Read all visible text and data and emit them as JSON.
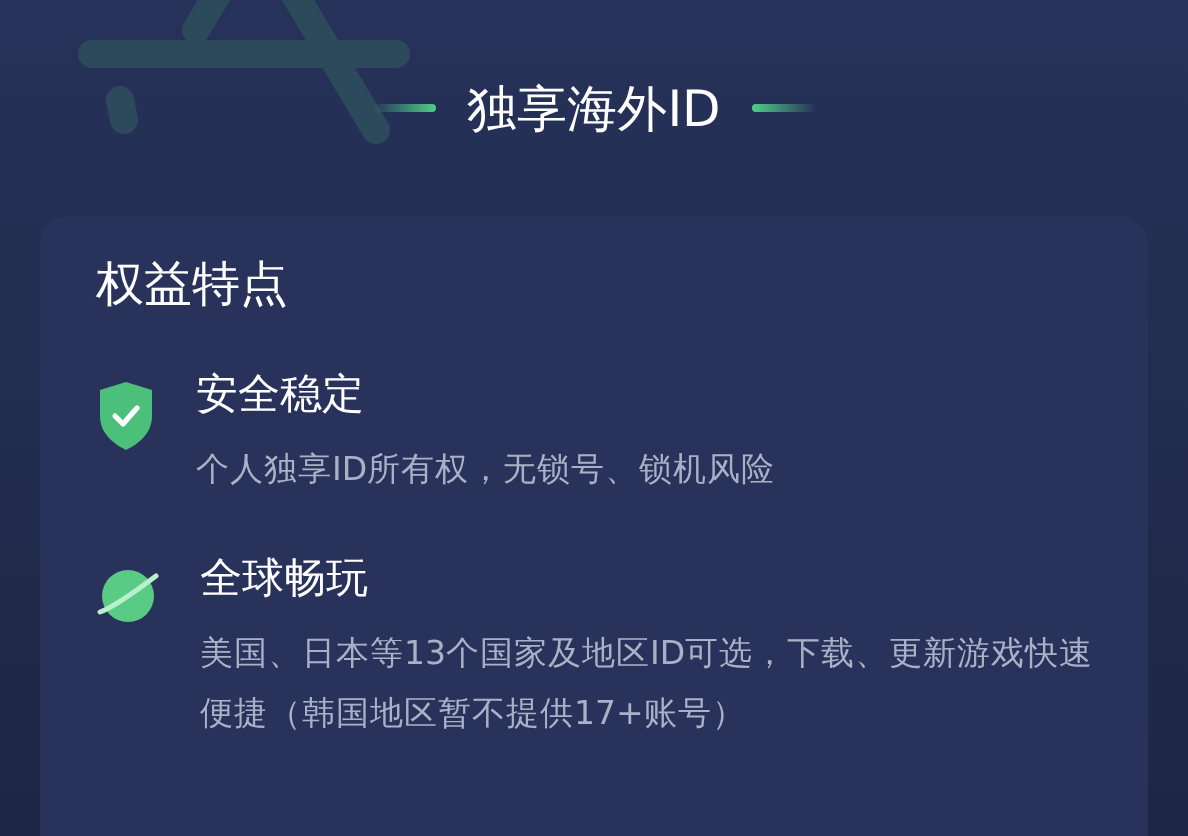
{
  "header": {
    "title": "独享海外ID"
  },
  "card": {
    "title": "权益特点",
    "features": [
      {
        "title": "安全稳定",
        "description": "个人独享ID所有权，无锁号、锁机风险"
      },
      {
        "title": "全球畅玩",
        "description": "美国、日本等13个国家及地区ID可选，下载、更新游戏快速便捷（韩国地区暂不提供17+账号）"
      }
    ]
  }
}
